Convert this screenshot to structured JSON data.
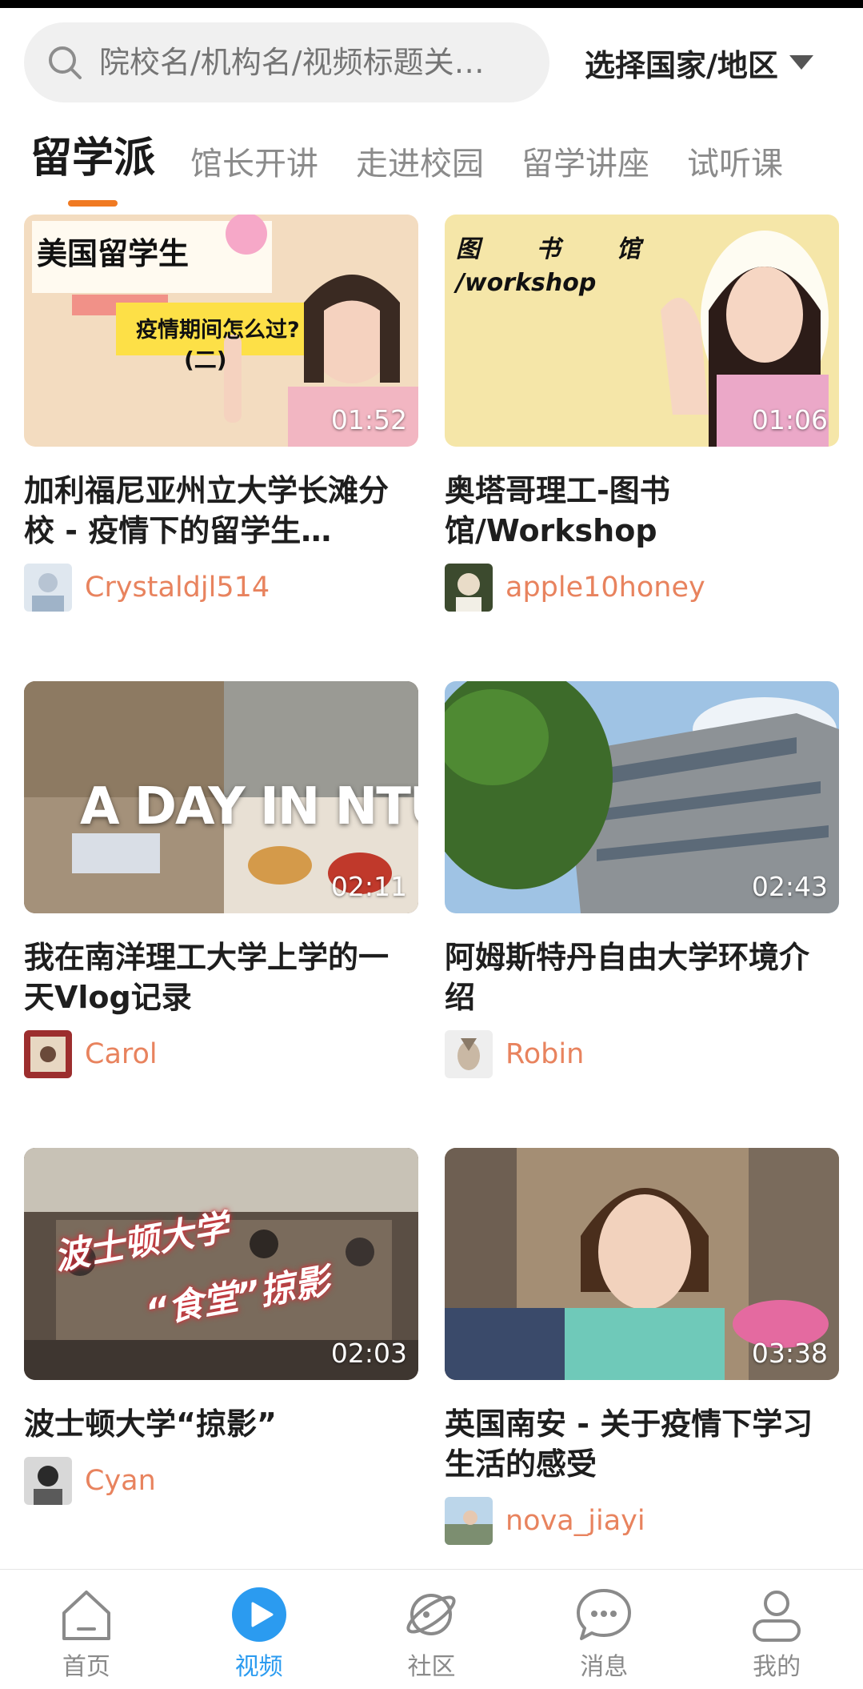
{
  "search": {
    "placeholder": "院校名/机构名/视频标题关…",
    "region_label": "选择国家/地区"
  },
  "tabs": [
    {
      "label": "留学派",
      "active": true
    },
    {
      "label": "馆长开讲",
      "active": false
    },
    {
      "label": "走进校园",
      "active": false
    },
    {
      "label": "留学讲座",
      "active": false
    },
    {
      "label": "试听课",
      "active": false
    }
  ],
  "videos": [
    {
      "title": "加利福尼亚州立大学长滩分校 - 疫情下的留学生…",
      "duration": "01:52",
      "author": "Crystaldjl514",
      "thumb_text": [
        "美国留学生",
        "疫情期间怎么过?",
        "(二)"
      ]
    },
    {
      "title": "奥塔哥理工-图书馆/Workshop",
      "duration": "01:06",
      "author": "apple10honey",
      "thumb_text": [
        "图 书 馆",
        "/workshop"
      ]
    },
    {
      "title": "我在南洋理工大学上学的一天Vlog记录",
      "duration": "02:11",
      "author": "Carol",
      "thumb_text": [
        "A DAY IN NTU"
      ]
    },
    {
      "title": "阿姆斯特丹自由大学环境介绍",
      "duration": "02:43",
      "author": "Robin",
      "thumb_text": []
    },
    {
      "title": "波士顿大学“掠影”",
      "duration": "02:03",
      "author": "Cyan",
      "thumb_text": [
        "波士顿大学",
        "“食堂”掠影"
      ]
    },
    {
      "title": "英国南安 - 关于疫情下学习生活的感受",
      "duration": "03:38",
      "author": "nova_jiayi",
      "thumb_text": []
    }
  ],
  "bottom_nav": [
    {
      "label": "首页",
      "icon": "home-icon",
      "active": false
    },
    {
      "label": "视频",
      "icon": "video-play-icon",
      "active": true
    },
    {
      "label": "社区",
      "icon": "planet-icon",
      "active": false
    },
    {
      "label": "消息",
      "icon": "message-bubble-icon",
      "active": false
    },
    {
      "label": "我的",
      "icon": "profile-icon",
      "active": false
    }
  ],
  "colors": {
    "accent_orange": "#f07a22",
    "author_text": "#e8835e",
    "nav_active_blue": "#2b9bf0",
    "search_bg": "#f0f0f0"
  }
}
